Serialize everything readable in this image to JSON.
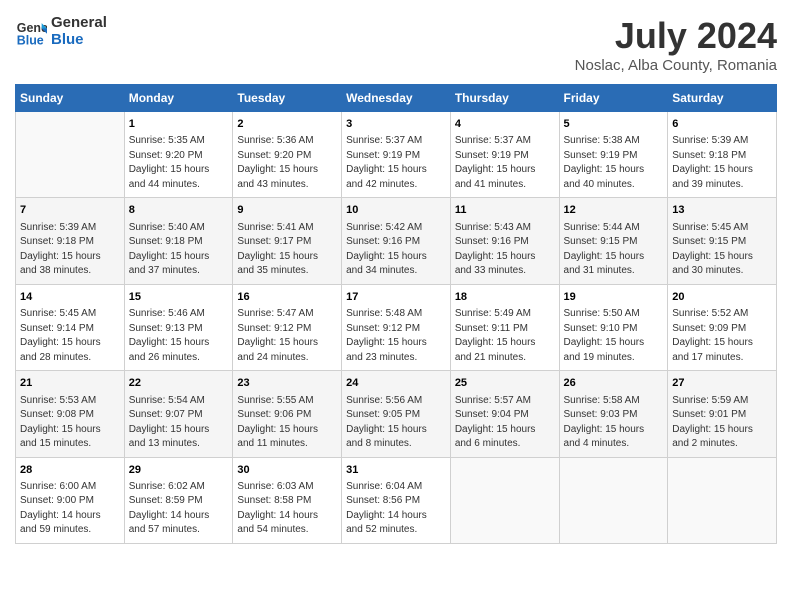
{
  "logo": {
    "line1": "General",
    "line2": "Blue"
  },
  "title": "July 2024",
  "subtitle": "Noslac, Alba County, Romania",
  "headers": [
    "Sunday",
    "Monday",
    "Tuesday",
    "Wednesday",
    "Thursday",
    "Friday",
    "Saturday"
  ],
  "weeks": [
    [
      {
        "day": "",
        "info": ""
      },
      {
        "day": "1",
        "info": "Sunrise: 5:35 AM\nSunset: 9:20 PM\nDaylight: 15 hours\nand 44 minutes."
      },
      {
        "day": "2",
        "info": "Sunrise: 5:36 AM\nSunset: 9:20 PM\nDaylight: 15 hours\nand 43 minutes."
      },
      {
        "day": "3",
        "info": "Sunrise: 5:37 AM\nSunset: 9:19 PM\nDaylight: 15 hours\nand 42 minutes."
      },
      {
        "day": "4",
        "info": "Sunrise: 5:37 AM\nSunset: 9:19 PM\nDaylight: 15 hours\nand 41 minutes."
      },
      {
        "day": "5",
        "info": "Sunrise: 5:38 AM\nSunset: 9:19 PM\nDaylight: 15 hours\nand 40 minutes."
      },
      {
        "day": "6",
        "info": "Sunrise: 5:39 AM\nSunset: 9:18 PM\nDaylight: 15 hours\nand 39 minutes."
      }
    ],
    [
      {
        "day": "7",
        "info": "Sunrise: 5:39 AM\nSunset: 9:18 PM\nDaylight: 15 hours\nand 38 minutes."
      },
      {
        "day": "8",
        "info": "Sunrise: 5:40 AM\nSunset: 9:18 PM\nDaylight: 15 hours\nand 37 minutes."
      },
      {
        "day": "9",
        "info": "Sunrise: 5:41 AM\nSunset: 9:17 PM\nDaylight: 15 hours\nand 35 minutes."
      },
      {
        "day": "10",
        "info": "Sunrise: 5:42 AM\nSunset: 9:16 PM\nDaylight: 15 hours\nand 34 minutes."
      },
      {
        "day": "11",
        "info": "Sunrise: 5:43 AM\nSunset: 9:16 PM\nDaylight: 15 hours\nand 33 minutes."
      },
      {
        "day": "12",
        "info": "Sunrise: 5:44 AM\nSunset: 9:15 PM\nDaylight: 15 hours\nand 31 minutes."
      },
      {
        "day": "13",
        "info": "Sunrise: 5:45 AM\nSunset: 9:15 PM\nDaylight: 15 hours\nand 30 minutes."
      }
    ],
    [
      {
        "day": "14",
        "info": "Sunrise: 5:45 AM\nSunset: 9:14 PM\nDaylight: 15 hours\nand 28 minutes."
      },
      {
        "day": "15",
        "info": "Sunrise: 5:46 AM\nSunset: 9:13 PM\nDaylight: 15 hours\nand 26 minutes."
      },
      {
        "day": "16",
        "info": "Sunrise: 5:47 AM\nSunset: 9:12 PM\nDaylight: 15 hours\nand 24 minutes."
      },
      {
        "day": "17",
        "info": "Sunrise: 5:48 AM\nSunset: 9:12 PM\nDaylight: 15 hours\nand 23 minutes."
      },
      {
        "day": "18",
        "info": "Sunrise: 5:49 AM\nSunset: 9:11 PM\nDaylight: 15 hours\nand 21 minutes."
      },
      {
        "day": "19",
        "info": "Sunrise: 5:50 AM\nSunset: 9:10 PM\nDaylight: 15 hours\nand 19 minutes."
      },
      {
        "day": "20",
        "info": "Sunrise: 5:52 AM\nSunset: 9:09 PM\nDaylight: 15 hours\nand 17 minutes."
      }
    ],
    [
      {
        "day": "21",
        "info": "Sunrise: 5:53 AM\nSunset: 9:08 PM\nDaylight: 15 hours\nand 15 minutes."
      },
      {
        "day": "22",
        "info": "Sunrise: 5:54 AM\nSunset: 9:07 PM\nDaylight: 15 hours\nand 13 minutes."
      },
      {
        "day": "23",
        "info": "Sunrise: 5:55 AM\nSunset: 9:06 PM\nDaylight: 15 hours\nand 11 minutes."
      },
      {
        "day": "24",
        "info": "Sunrise: 5:56 AM\nSunset: 9:05 PM\nDaylight: 15 hours\nand 8 minutes."
      },
      {
        "day": "25",
        "info": "Sunrise: 5:57 AM\nSunset: 9:04 PM\nDaylight: 15 hours\nand 6 minutes."
      },
      {
        "day": "26",
        "info": "Sunrise: 5:58 AM\nSunset: 9:03 PM\nDaylight: 15 hours\nand 4 minutes."
      },
      {
        "day": "27",
        "info": "Sunrise: 5:59 AM\nSunset: 9:01 PM\nDaylight: 15 hours\nand 2 minutes."
      }
    ],
    [
      {
        "day": "28",
        "info": "Sunrise: 6:00 AM\nSunset: 9:00 PM\nDaylight: 14 hours\nand 59 minutes."
      },
      {
        "day": "29",
        "info": "Sunrise: 6:02 AM\nSunset: 8:59 PM\nDaylight: 14 hours\nand 57 minutes."
      },
      {
        "day": "30",
        "info": "Sunrise: 6:03 AM\nSunset: 8:58 PM\nDaylight: 14 hours\nand 54 minutes."
      },
      {
        "day": "31",
        "info": "Sunrise: 6:04 AM\nSunset: 8:56 PM\nDaylight: 14 hours\nand 52 minutes."
      },
      {
        "day": "",
        "info": ""
      },
      {
        "day": "",
        "info": ""
      },
      {
        "day": "",
        "info": ""
      }
    ]
  ]
}
